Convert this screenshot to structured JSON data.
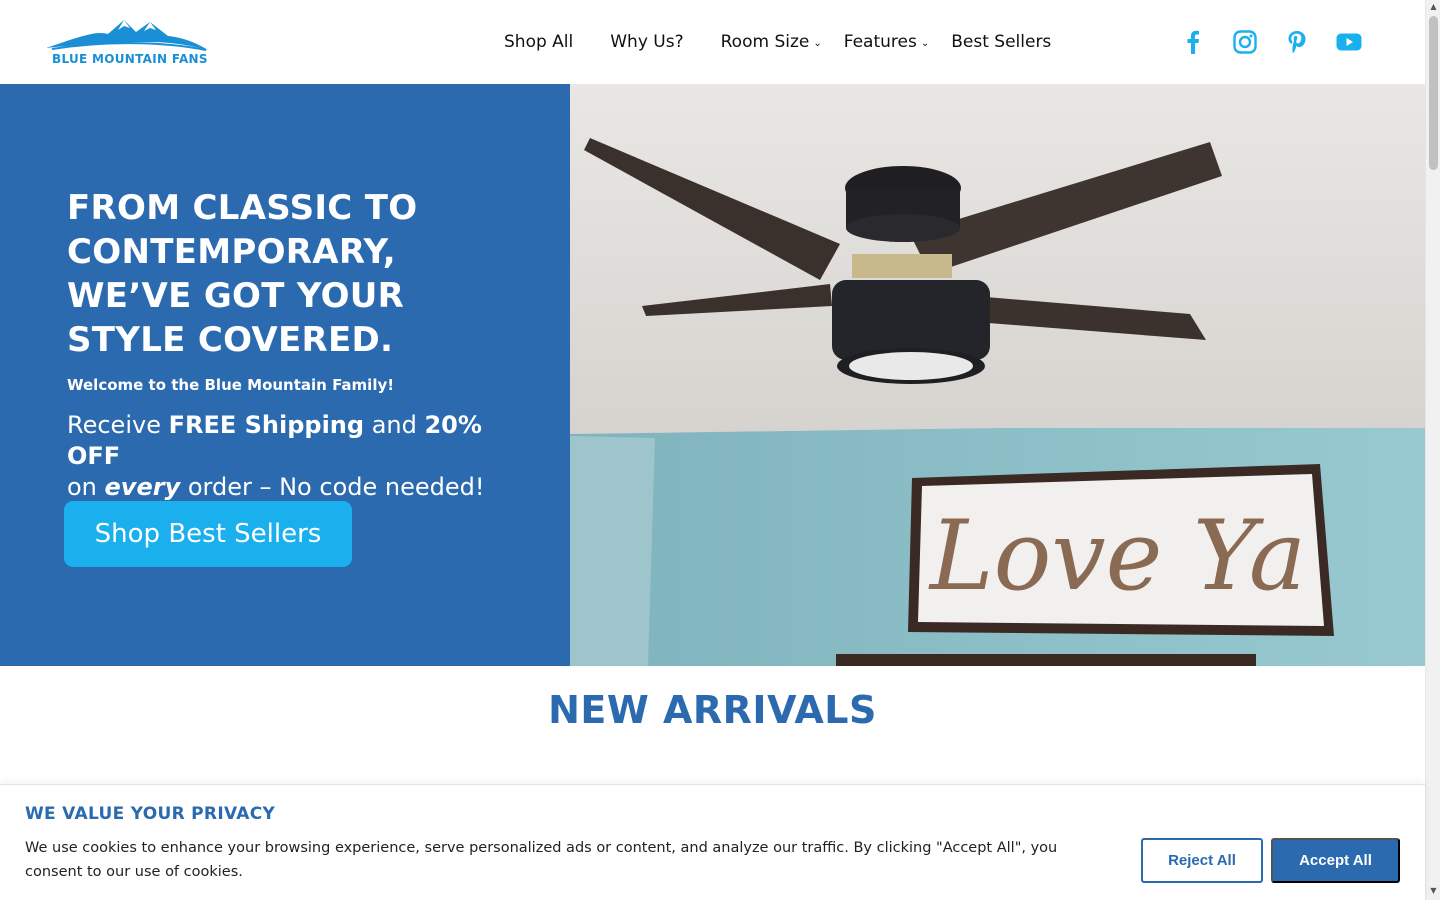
{
  "brand": {
    "name": "BLUE MOUNTAIN FANS",
    "logo_color": "#1a8fd6"
  },
  "nav": {
    "items": [
      {
        "label": "Shop All",
        "has_dropdown": false
      },
      {
        "label": "Why Us?",
        "has_dropdown": false
      },
      {
        "label": "Room Size",
        "has_dropdown": true
      },
      {
        "label": "Features",
        "has_dropdown": true
      },
      {
        "label": "Best Sellers",
        "has_dropdown": false
      }
    ]
  },
  "social": {
    "icons": [
      "facebook-icon",
      "instagram-icon",
      "pinterest-icon",
      "youtube-icon"
    ],
    "color": "#1ab0ee"
  },
  "hero": {
    "title": "FROM CLASSIC TO CONTEMPORARY, WE’VE GOT YOUR STYLE COVERED.",
    "welcome": "Welcome to the Blue Mountain Family!",
    "offer_receive": "Receive ",
    "offer_free_shipping": "FREE Shipping",
    "offer_and": " and ",
    "offer_discount": "20% OFF",
    "offer_on": "on ",
    "offer_every": "every",
    "offer_rest": " order – No code needed!",
    "button_label": "Shop Best Sellers",
    "bg_color": "#2b6aae",
    "button_color": "#1ab0ee",
    "image_sign_text": "Love Ya"
  },
  "new_arrivals": {
    "title": "NEW ARRIVALS"
  },
  "cookie_banner": {
    "title": "WE VALUE YOUR PRIVACY",
    "text": "We use cookies to enhance your browsing experience, serve personalized ads or content, and analyze our traffic. By clicking \"Accept All\", you consent to our use of cookies.",
    "reject_label": "Reject All",
    "accept_label": "Accept All"
  }
}
